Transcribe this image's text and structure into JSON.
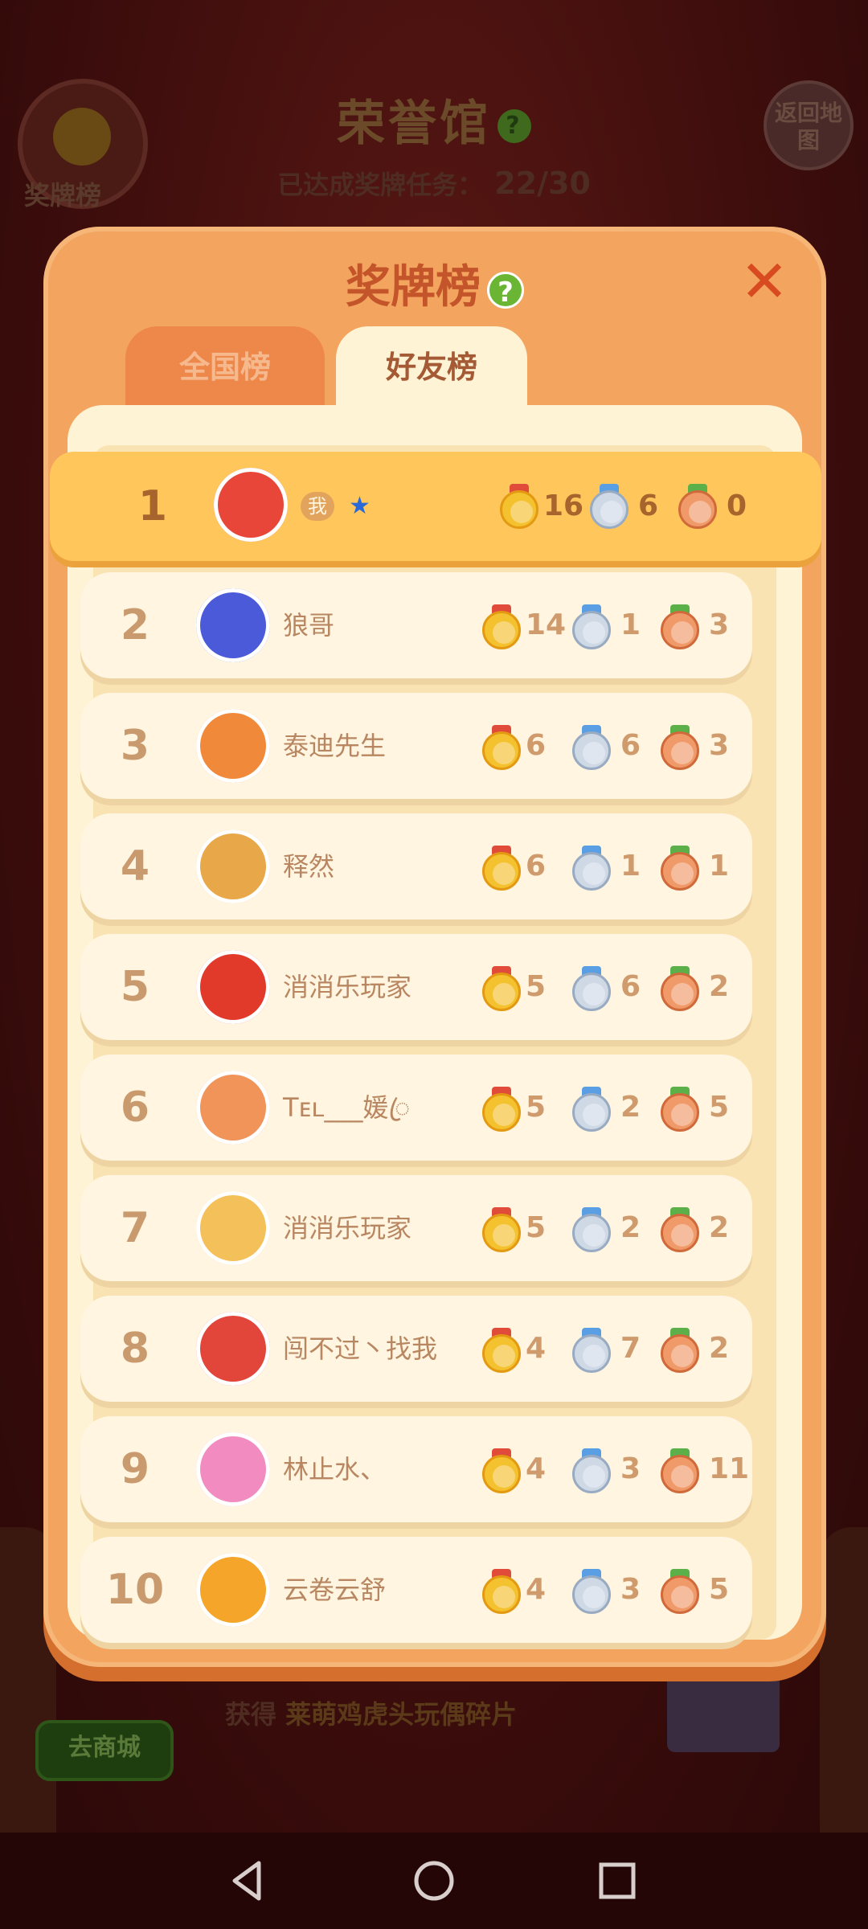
{
  "background": {
    "title": "荣誉馆",
    "title_help": "?",
    "progress_label": "已达成奖牌任务：",
    "progress_value": "22/30",
    "medal_button_label": "奖牌榜",
    "back_button_label": "返回地图",
    "shop_button_label": "去商城",
    "reward_prefix": "获得",
    "reward_item": "莱萌鸡虎头玩偶碎片"
  },
  "modal": {
    "title": "奖牌榜",
    "help": "?",
    "close": "✕",
    "tabs": [
      {
        "label": "全国榜",
        "active": false
      },
      {
        "label": "好友榜",
        "active": true
      }
    ]
  },
  "me_badge": "我",
  "leaderboard": [
    {
      "rank": "1",
      "name": "",
      "is_me": true,
      "gold": "16",
      "silver": "6",
      "bronze": "0",
      "avatar_color": "#e9463a"
    },
    {
      "rank": "2",
      "name": "狼哥",
      "gold": "14",
      "silver": "1",
      "bronze": "3",
      "avatar_color": "#4a5ad8"
    },
    {
      "rank": "3",
      "name": "泰迪先生",
      "gold": "6",
      "silver": "6",
      "bronze": "3",
      "avatar_color": "#f08a3a"
    },
    {
      "rank": "4",
      "name": "释然",
      "gold": "6",
      "silver": "1",
      "bronze": "1",
      "avatar_color": "#e8a84a"
    },
    {
      "rank": "5",
      "name": "消消乐玩家",
      "gold": "5",
      "silver": "6",
      "bronze": "2",
      "avatar_color": "#e23a2a"
    },
    {
      "rank": "6",
      "name": "Tᴇʟ___媛ꦿ",
      "gold": "5",
      "silver": "2",
      "bronze": "5",
      "avatar_color": "#f0945a"
    },
    {
      "rank": "7",
      "name": "消消乐玩家",
      "gold": "5",
      "silver": "2",
      "bronze": "2",
      "avatar_color": "#f4c05a"
    },
    {
      "rank": "8",
      "name": "闯不过丶找我",
      "gold": "4",
      "silver": "7",
      "bronze": "2",
      "avatar_color": "#e2463a"
    },
    {
      "rank": "9",
      "name": "林止水、",
      "gold": "4",
      "silver": "3",
      "bronze": "11",
      "avatar_color": "#f28cc0"
    },
    {
      "rank": "10",
      "name": "云卷云舒",
      "gold": "4",
      "silver": "3",
      "bronze": "5",
      "avatar_color": "#f4a52a"
    }
  ]
}
